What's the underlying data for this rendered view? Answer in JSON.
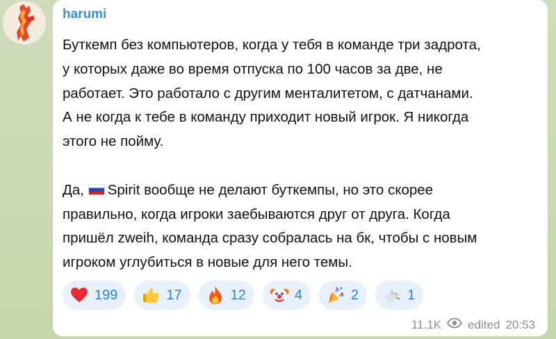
{
  "sender": {
    "name": "harumi",
    "color": "#3a8fd1"
  },
  "message": {
    "paragraph1_lines": [
      "Буткемп без компьютеров, когда у тебя в команде три задрота,",
      "у которых даже во время отпуска по 100 часов за две, не",
      "работает. Это работало с другим менталитетом, с датчанами.",
      "А не когда к тебе в команду приходит новый игрок. Я никогда",
      "этого не пойму."
    ],
    "paragraph2_prefix": "Да,",
    "paragraph2_flag": "russia-flag",
    "paragraph2_line1_rest": "Spirit вообще не делают буткемпы, но это скорее",
    "paragraph2_lines": [
      "правильно, когда игроки заебываются друг от друга. Когда",
      "пришёл zweih, команда сразу собралась на бк, чтобы с новым",
      "игроком углубиться в новые для него темы."
    ]
  },
  "reactions": [
    {
      "icon": "heart-icon",
      "count": "199"
    },
    {
      "icon": "thumbs-up-icon",
      "count": "17"
    },
    {
      "icon": "fire-icon",
      "count": "12"
    },
    {
      "icon": "clown-icon",
      "count": "4"
    },
    {
      "icon": "party-popper-icon",
      "count": "2"
    },
    {
      "icon": "dove-icon",
      "count": "1"
    }
  ],
  "meta": {
    "views": "11.1K",
    "views_icon": "eye-icon",
    "edited_label": "edited",
    "time": "20:53"
  },
  "colors": {
    "bubble": "#ffffff",
    "reaction_bg": "#e8f1fb",
    "reaction_text": "#2a83cf",
    "meta_text": "#8a8f94"
  }
}
